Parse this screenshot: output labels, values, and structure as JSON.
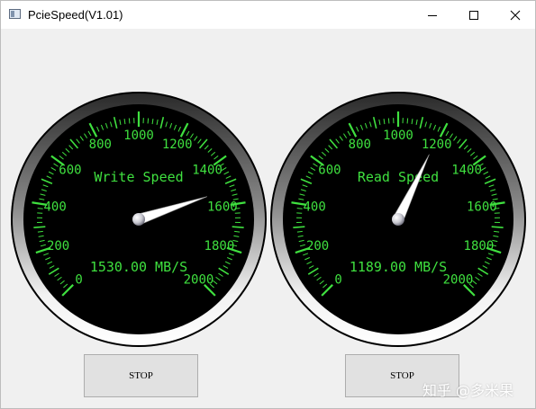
{
  "window": {
    "title": "PcieSpeed(V1.01)",
    "min_icon": "minimize-icon",
    "max_icon": "maximize-icon",
    "close_icon": "close-icon"
  },
  "gauges": [
    {
      "title": "Write Speed",
      "value_text": "1530.00 MB/S",
      "value": 1530,
      "min": 0,
      "max": 2000,
      "tick_labels": [
        "0",
        "200",
        "400",
        "600",
        "800",
        "1000",
        "1200",
        "1400",
        "1600",
        "1800",
        "2000"
      ]
    },
    {
      "title": "Read Speed",
      "value_text": "1189.00 MB/S",
      "value": 1189,
      "min": 0,
      "max": 2000,
      "tick_labels": [
        "0",
        "200",
        "400",
        "600",
        "800",
        "1000",
        "1200",
        "1400",
        "1600",
        "1800",
        "2000"
      ]
    }
  ],
  "buttons": {
    "stop_write_label": "STOP",
    "stop_read_label": "STOP"
  },
  "watermark": "知乎 @多米果",
  "colors": {
    "dial_text": "#3fe03f",
    "dial_face": "#000000",
    "needle": "#ffffff"
  }
}
